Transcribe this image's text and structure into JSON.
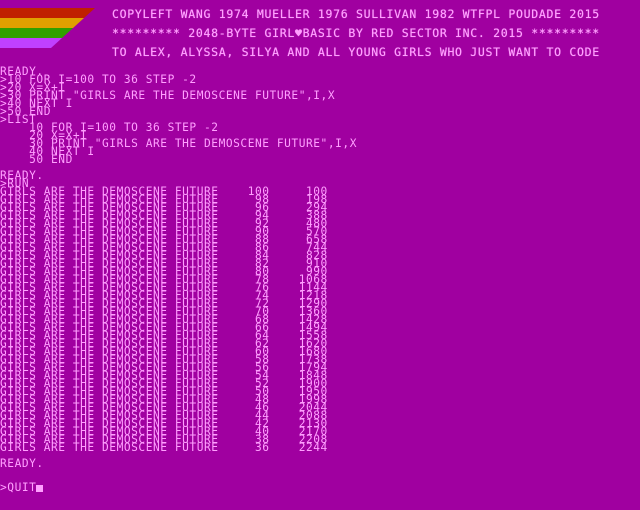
{
  "logo": {
    "name": "red-sector-logo",
    "stripe_colors": [
      "#c02000",
      "#e0a000",
      "#30a000",
      "#a000a0"
    ]
  },
  "header": {
    "line1": "COPYLEFT WANG 1974 MUELLER 1976 SULLIVAN 1982 WTFPL POUDADE 2015",
    "line2": "********* 2048-BYTE GIRL♥BASIC BY RED SECTOR INC. 2015 *********",
    "line3": "TO ALEX, ALYSSA, SILYA AND ALL YOUNG GIRLS WHO JUST WANT TO CODE"
  },
  "terminal": {
    "lines": [
      "READY.",
      ">10 FOR I=100 TO 36 STEP -2",
      ">20 X=X+I",
      ">30 PRINT \"GIRLS ARE THE DEMOSCENE FUTURE\",I,X",
      ">40 NEXT I",
      ">50 END",
      ">LIST",
      "    10 FOR I=100 TO 36 STEP -2",
      "    20 X=X+I",
      "    30 PRINT \"GIRLS ARE THE DEMOSCENE FUTURE\",I,X",
      "    40 NEXT I",
      "    50 END",
      "",
      "READY.",
      ">RUN",
      "GIRLS ARE THE DEMOSCENE FUTURE    100     100",
      "GIRLS ARE THE DEMOSCENE FUTURE     98     198",
      "GIRLS ARE THE DEMOSCENE FUTURE     96     294",
      "GIRLS ARE THE DEMOSCENE FUTURE     94     388",
      "GIRLS ARE THE DEMOSCENE FUTURE     92     480",
      "GIRLS ARE THE DEMOSCENE FUTURE     90     570",
      "GIRLS ARE THE DEMOSCENE FUTURE     88     658",
      "GIRLS ARE THE DEMOSCENE FUTURE     86     744",
      "GIRLS ARE THE DEMOSCENE FUTURE     84     828",
      "GIRLS ARE THE DEMOSCENE FUTURE     82     910",
      "GIRLS ARE THE DEMOSCENE FUTURE     80     990",
      "GIRLS ARE THE DEMOSCENE FUTURE     78    1068",
      "GIRLS ARE THE DEMOSCENE FUTURE     76    1144",
      "GIRLS ARE THE DEMOSCENE FUTURE     74    1218",
      "GIRLS ARE THE DEMOSCENE FUTURE     72    1290",
      "GIRLS ARE THE DEMOSCENE FUTURE     70    1360",
      "GIRLS ARE THE DEMOSCENE FUTURE     68    1428",
      "GIRLS ARE THE DEMOSCENE FUTURE     66    1494",
      "GIRLS ARE THE DEMOSCENE FUTURE     64    1558",
      "GIRLS ARE THE DEMOSCENE FUTURE     62    1620",
      "GIRLS ARE THE DEMOSCENE FUTURE     60    1680",
      "GIRLS ARE THE DEMOSCENE FUTURE     58    1738",
      "GIRLS ARE THE DEMOSCENE FUTURE     56    1794",
      "GIRLS ARE THE DEMOSCENE FUTURE     54    1848",
      "GIRLS ARE THE DEMOSCENE FUTURE     52    1900",
      "GIRLS ARE THE DEMOSCENE FUTURE     50    1950",
      "GIRLS ARE THE DEMOSCENE FUTURE     48    1998",
      "GIRLS ARE THE DEMOSCENE FUTURE     46    2044",
      "GIRLS ARE THE DEMOSCENE FUTURE     44    2088",
      "GIRLS ARE THE DEMOSCENE FUTURE     42    2130",
      "GIRLS ARE THE DEMOSCENE FUTURE     40    2170",
      "GIRLS ARE THE DEMOSCENE FUTURE     38    2208",
      "GIRLS ARE THE DEMOSCENE FUTURE     36    2244",
      "",
      "READY."
    ],
    "input_prompt": ">QUIT",
    "cursor_icon": "block-cursor-icon"
  },
  "colors": {
    "background": "#a000a0",
    "text": "#ffa0ff"
  }
}
